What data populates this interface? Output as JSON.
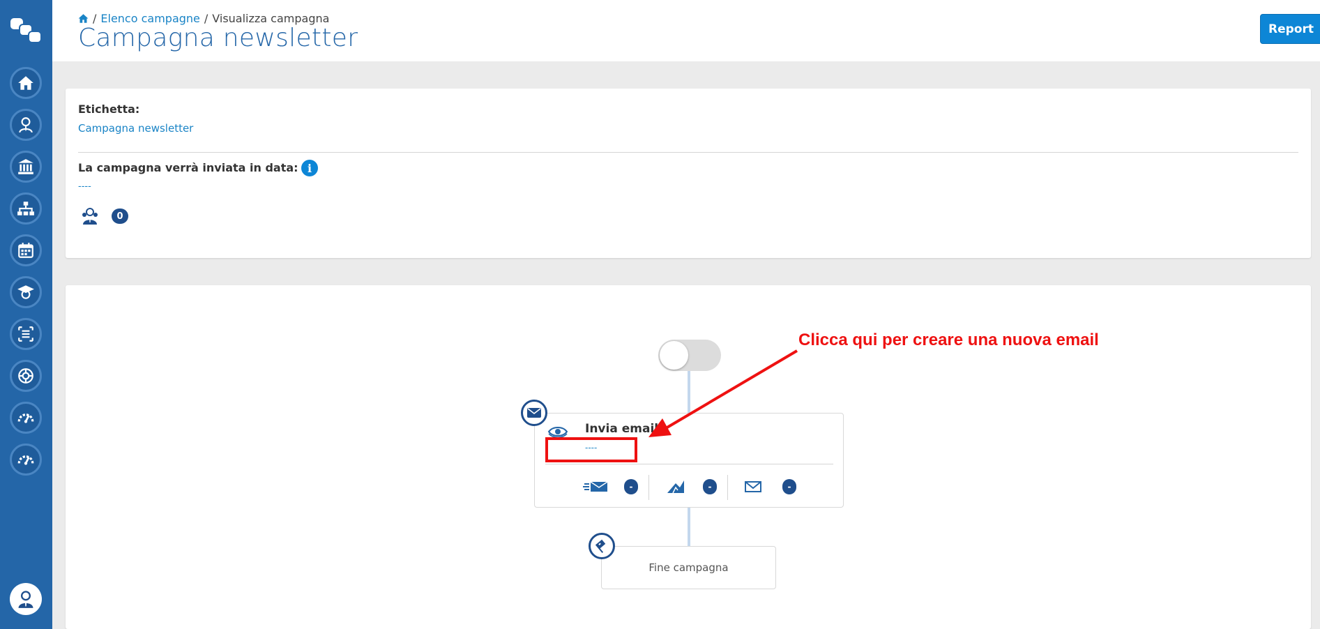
{
  "breadcrumb": {
    "home_icon": "home-icon",
    "link": "Elenco campagne",
    "current": "Visualizza campagna",
    "separator": "/"
  },
  "page_title": "Campagna newsletter",
  "report_button": {
    "label": "Report",
    "caret_icon": "chevron-down-icon"
  },
  "sidebar": {
    "items": [
      {
        "icon": "home-icon"
      },
      {
        "icon": "user-tie-icon"
      },
      {
        "icon": "bank-icon"
      },
      {
        "icon": "org-chart-icon"
      },
      {
        "icon": "calendar-icon"
      },
      {
        "icon": "graduate-icon"
      },
      {
        "icon": "list-icon"
      },
      {
        "icon": "network-globe-icon"
      },
      {
        "icon": "gauge-icon"
      },
      {
        "icon": "gauge-icon"
      }
    ],
    "profile_icon": "user-avatar-icon"
  },
  "campaign": {
    "label_title": "Etichetta:",
    "label_value": "Campagna newsletter",
    "send_date_title": "La campagna verrà inviata in data:",
    "send_date_value": "----",
    "recipients_count": "0"
  },
  "flow": {
    "toggle_on": false,
    "email_step": {
      "title": "Invia email",
      "subtitle": "----",
      "stats": [
        {
          "icon": "sent-icon",
          "value": "-"
        },
        {
          "icon": "opened-icon",
          "value": "-"
        },
        {
          "icon": "envelope-icon",
          "value": "-"
        }
      ]
    },
    "end_step": {
      "label": "Fine campagna"
    }
  },
  "annotation": {
    "text": "Clicca qui per creare una nuova email",
    "color": "#ee1111"
  },
  "colors": {
    "sidebar": "#2466a8",
    "accent": "#0d86d6",
    "badge": "#1f4e8c",
    "title": "#2466a8"
  }
}
